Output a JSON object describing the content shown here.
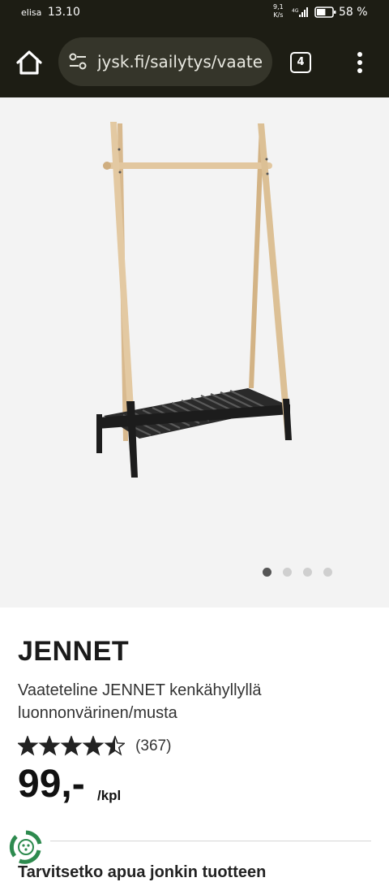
{
  "status_bar": {
    "carrier": "elisa",
    "time": "13.10",
    "net_speed_value": "9,1",
    "net_speed_unit": "K/s",
    "network": "4G",
    "battery_percent": "58 %"
  },
  "browser": {
    "url": "jysk.fi/sailytys/vaate",
    "tab_count": "4",
    "icons": {
      "home": "home-icon",
      "site_settings": "tune-icon",
      "menu": "more-vert-icon"
    }
  },
  "gallery": {
    "image_count": 4,
    "active_index": 0
  },
  "product": {
    "name": "JENNET",
    "description": "Vaateteline JENNET kenkähyllyllä luonnonvärinen/musta",
    "rating": 4.5,
    "rating_max": 5,
    "review_count": "(367)",
    "price": "99,-",
    "unit": "/kpl"
  },
  "next_section_text": "Tarvitsetko apua jonkin tuotteen"
}
